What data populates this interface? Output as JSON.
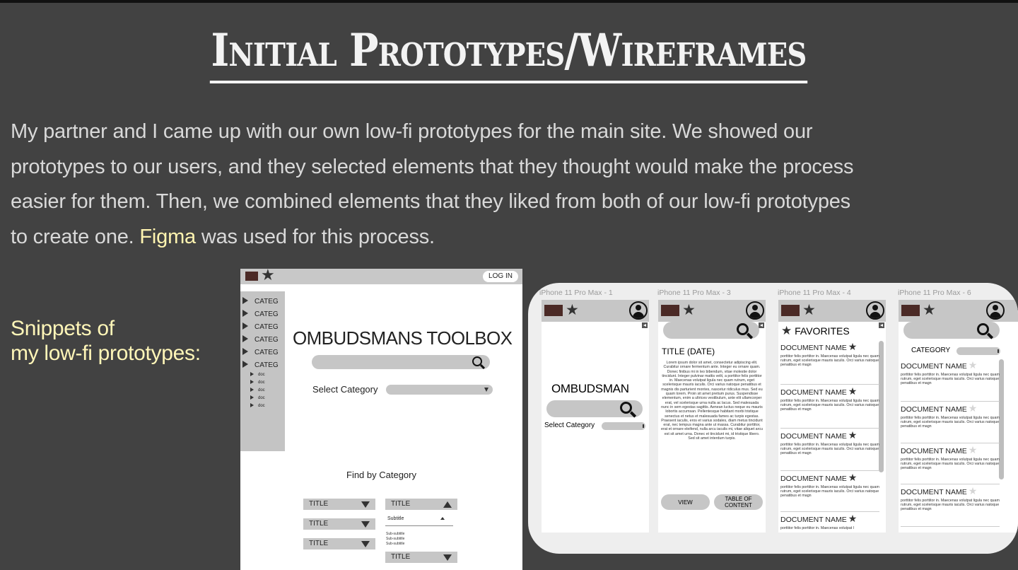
{
  "title": "Initial Prototypes/Wireframes",
  "intro": {
    "line1": "My partner and I came up with our own low-fi prototypes for the main site. We showed our",
    "line2": "prototypes to our users, and they selected elements that they thought would make the process",
    "line3": "easier for them. Then, we combined elements that they liked from both of our low-fi prototypes",
    "line4_prefix": "to create one.",
    "tool": "Figma",
    "line4_suffix": "was used for this process."
  },
  "snippets": {
    "line1": "Snippets of",
    "line2": "my low-fi prototypes:"
  },
  "colors": {
    "background": "#424242",
    "accent_text": "#fff6b8",
    "frame": "#c6c6c6"
  },
  "desktop": {
    "login": "LOG IN",
    "categories": [
      "CATEG",
      "CATEG",
      "CATEG",
      "CATEG",
      "CATEG",
      "CATEG"
    ],
    "docs": [
      "doc",
      "doc",
      "doc",
      "doc",
      "doc"
    ],
    "brand": "OMBUDSMANS TOOLBOX",
    "select_label": "Select Category",
    "find_by": "Find by Category",
    "title_label": "TITLE",
    "subtitle": "Subtitle",
    "subsubtitles": [
      "Sub-subtitle",
      "Sub-subtitle",
      "Sub-subtitle"
    ]
  },
  "phones": {
    "labels": [
      "iPhone 11 Pro Max - 1",
      "iPhone 11 Pro Max - 3",
      "iPhone 11 Pro Max - 4",
      "iPhone 11 Pro Max - 6"
    ],
    "p1": {
      "brand": "OMBUDSMAN",
      "select_label": "Select Category"
    },
    "p2": {
      "title": "TITLE (DATE)",
      "body": "Lorem ipsum dolor sit amet, consectetur adipiscing elit. Curabitur ornare fermentum ante. Integer eu ornare quam. Donec finibus mi in leo bibendum, vitae molestie dolor tincidunt. Integer pulvinar mattis velit, a porttitor felis porttitor in. Maecenas volutpat ligula nec quam rutrum, eget scelerisque mauris iaculis. Orci varius natoque penatibus et magnis dis parturient montes, nascetur ridiculus mus. Sed eu quam lorem. Proin sit amet pretium purus. Suspendisse elementum, enim a ultrices vestibulum, ante elit ullamcorper erat, vel scelerisque urna nulla ac lacus. Sed malesuada nunc in sem egestas sagittis. Aenean luctus neque eu mauris lobortis accumsan. Pellentesque habitant morbi tristique senectus et netus et malesuada fames ac turpis egestas. Praesent iaculis, eros et varius sodales, diam metus tincidunt erat, nec tempus magna ante ut massa. Curabitur porttitor, erat et ornare eleifend, nulla arcu iaculis mi, vitae aliquet arcu est sit amet urna. Donec et tincidunt mi, id tristique libero. Sed sit amet interdum turpis.",
      "view": "VIEW",
      "toc": "TABLE OF CONTENT"
    },
    "p4": {
      "header": "FAVORITES"
    },
    "p6": {
      "category": "CATEGORY"
    },
    "doc_name": "DOCUMENT NAME",
    "doc_desc": "porttitor felis porttitor in. Maecenas volutpat ligula nec quam rutrum, eget scelerisque mauris iaculis. Orci varius natoque penatibus et magn",
    "doc_desc_short": "porttitor felis porttitor in. Maecenas volutpat l"
  }
}
